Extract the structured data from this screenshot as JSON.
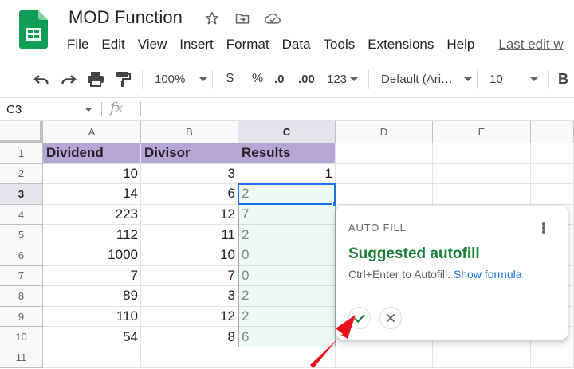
{
  "document": {
    "title": "MOD Function"
  },
  "menu": {
    "items": [
      "File",
      "Edit",
      "View",
      "Insert",
      "Format",
      "Data",
      "Tools",
      "Extensions",
      "Help"
    ],
    "last_edit": "Last edit w"
  },
  "toolbar": {
    "zoom": "100%",
    "currency": "$",
    "percent": "%",
    "decrease_decimal": ".0",
    "increase_decimal": ".00",
    "number_format": "123",
    "font": "Default (Ari…",
    "font_size": "10",
    "bold": "B"
  },
  "formula_bar": {
    "cell_ref": "C3",
    "fx": "fx",
    "content": ""
  },
  "sheet": {
    "columns": [
      "A",
      "B",
      "C",
      "D",
      "E"
    ],
    "rows": [
      "1",
      "2",
      "3",
      "4",
      "5",
      "6",
      "7",
      "8",
      "9",
      "10",
      "11"
    ],
    "headers": [
      "Dividend",
      "Divisor",
      "Results"
    ],
    "data": [
      {
        "dividend": "10",
        "divisor": "3",
        "result": "1"
      },
      {
        "dividend": "14",
        "divisor": "6",
        "result": "2"
      },
      {
        "dividend": "223",
        "divisor": "12",
        "result": "7"
      },
      {
        "dividend": "112",
        "divisor": "11",
        "result": "2"
      },
      {
        "dividend": "1000",
        "divisor": "10",
        "result": "0"
      },
      {
        "dividend": "7",
        "divisor": "7",
        "result": "0"
      },
      {
        "dividend": "89",
        "divisor": "3",
        "result": "2"
      },
      {
        "dividend": "110",
        "divisor": "12",
        "result": "2"
      },
      {
        "dividend": "54",
        "divisor": "8",
        "result": "6"
      }
    ],
    "active_cell": "C3"
  },
  "autofill_popup": {
    "label": "AUTO FILL",
    "title": "Suggested autofill",
    "hint": "Ctrl+Enter to Autofill.",
    "link": "Show formula"
  },
  "colors": {
    "header_fill": "#b4a7d6",
    "accent_blue": "#1a73e8",
    "suggest_green": "#188038",
    "arrow_red": "#e8101a",
    "sheets_green": "#0f9d58"
  },
  "icons": [
    "sheets-logo-icon",
    "star-icon",
    "move-folder-icon",
    "cloud-status-icon",
    "undo-icon",
    "redo-icon",
    "print-icon",
    "paint-format-icon",
    "more-vert-icon",
    "accept-check-icon",
    "reject-x-icon"
  ]
}
